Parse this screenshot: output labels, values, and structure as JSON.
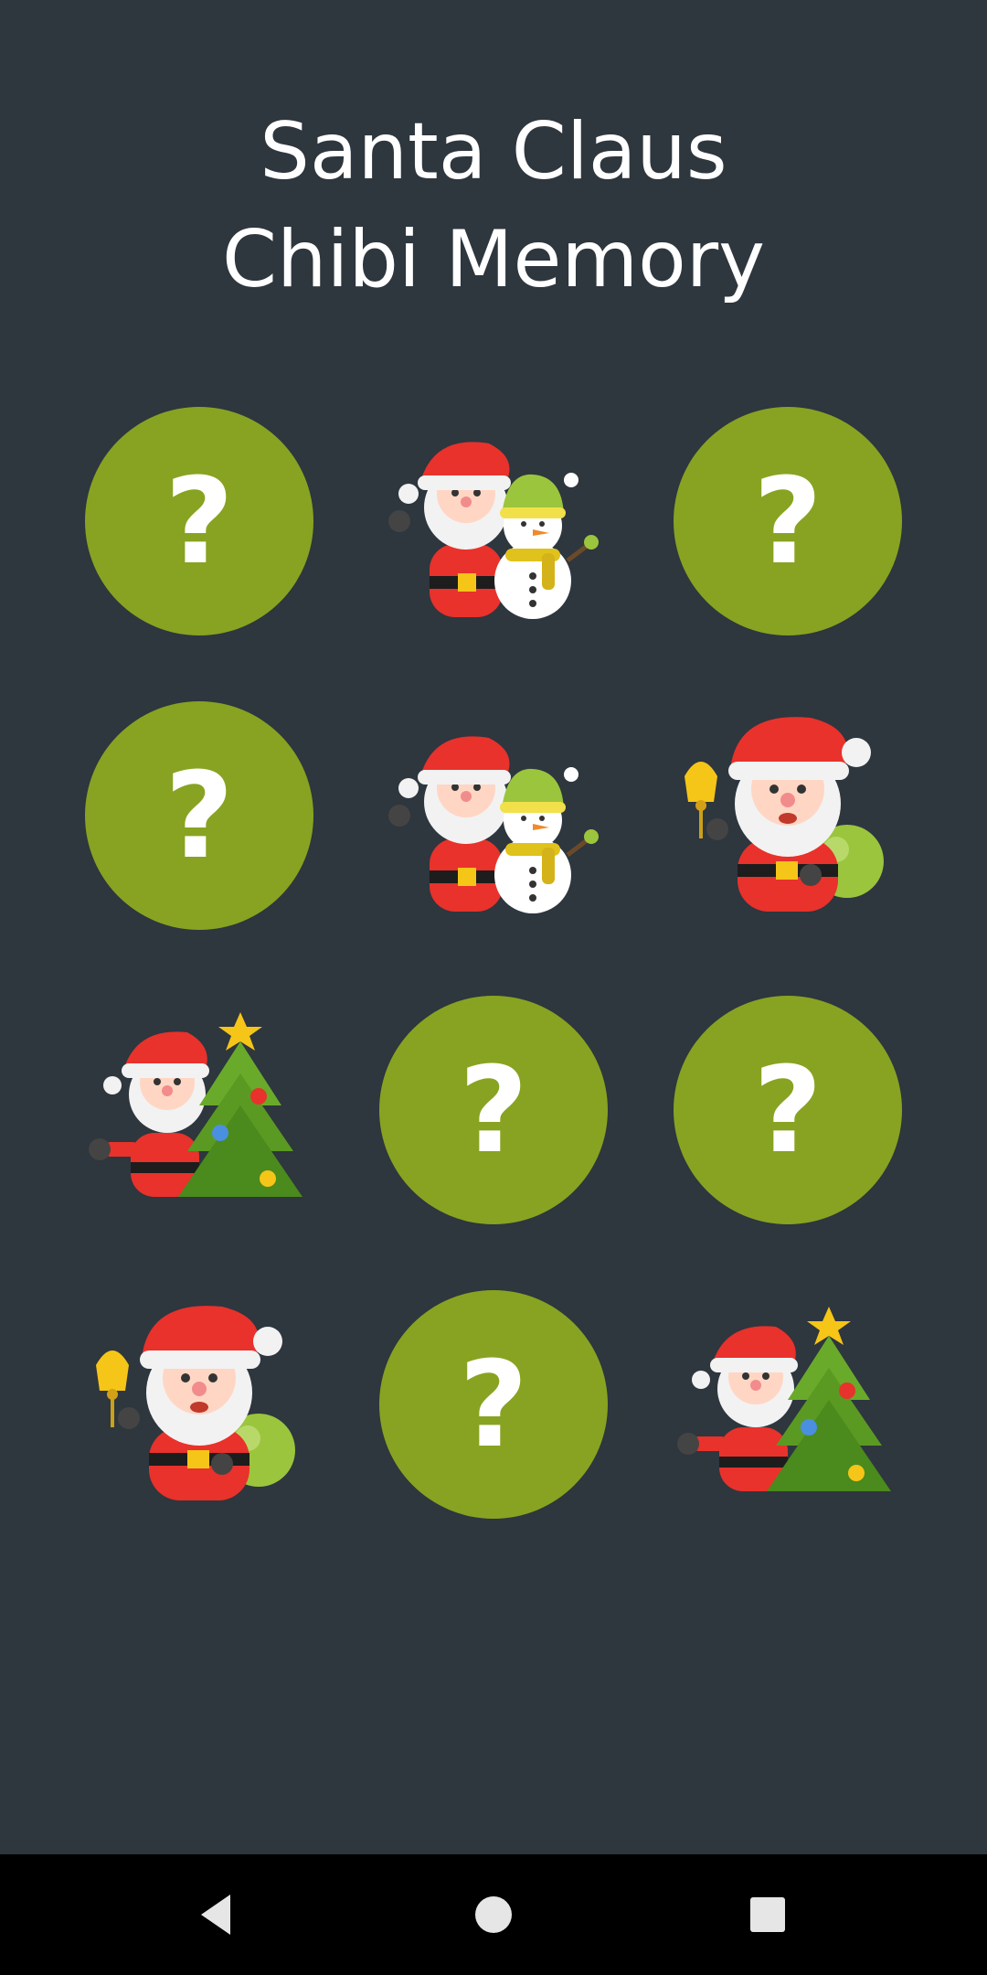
{
  "app": {
    "title_line1": "Santa Claus",
    "title_line2": "Chibi Memory"
  },
  "board": {
    "rows": 4,
    "columns": 3,
    "hidden_symbol": "?",
    "card_color": "#88a321",
    "background_color": "#2e363e",
    "cards": [
      {
        "state": "hidden"
      },
      {
        "state": "revealed",
        "icon": "santa-snowman-icon"
      },
      {
        "state": "hidden"
      },
      {
        "state": "hidden"
      },
      {
        "state": "revealed",
        "icon": "santa-snowman-icon"
      },
      {
        "state": "revealed",
        "icon": "santa-bell-sack-icon"
      },
      {
        "state": "revealed",
        "icon": "santa-christmas-tree-icon"
      },
      {
        "state": "hidden"
      },
      {
        "state": "hidden"
      },
      {
        "state": "revealed",
        "icon": "santa-bell-sack-icon"
      },
      {
        "state": "hidden"
      },
      {
        "state": "revealed",
        "icon": "santa-christmas-tree-icon"
      }
    ]
  },
  "navigation_bar": {
    "buttons": [
      "back-icon",
      "home-icon",
      "recents-icon"
    ]
  }
}
